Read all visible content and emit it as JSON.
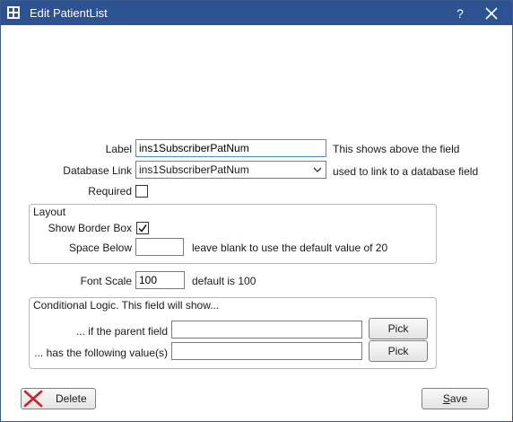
{
  "window": {
    "title": "Edit PatientList",
    "help": "?"
  },
  "label_row": {
    "label": "Label",
    "value": "ins1SubscriberPatNum",
    "hint": "This shows above the field"
  },
  "db_row": {
    "label": "Database Link",
    "value": "ins1SubscriberPatNum",
    "hint": "used to link to a database field"
  },
  "required": {
    "label": "Required",
    "checked": false
  },
  "layout": {
    "title": "Layout",
    "border_box_label": "Show Border Box",
    "border_box_checked": true,
    "space_below_label": "Space Below",
    "space_below_value": "",
    "space_below_hint": "leave blank to use the default value of 20"
  },
  "font_scale": {
    "label": "Font Scale",
    "value": "100",
    "hint": "default is 100"
  },
  "conditional": {
    "title": "Conditional Logic. This field will show...",
    "parent_label": "... if the parent field",
    "parent_value": "",
    "value_label": "... has the following value(s)",
    "value_value": "",
    "pick_label": "Pick"
  },
  "buttons": {
    "delete": "Delete",
    "save_prefix": "",
    "save_underlined": "S",
    "save_rest": "ave"
  }
}
